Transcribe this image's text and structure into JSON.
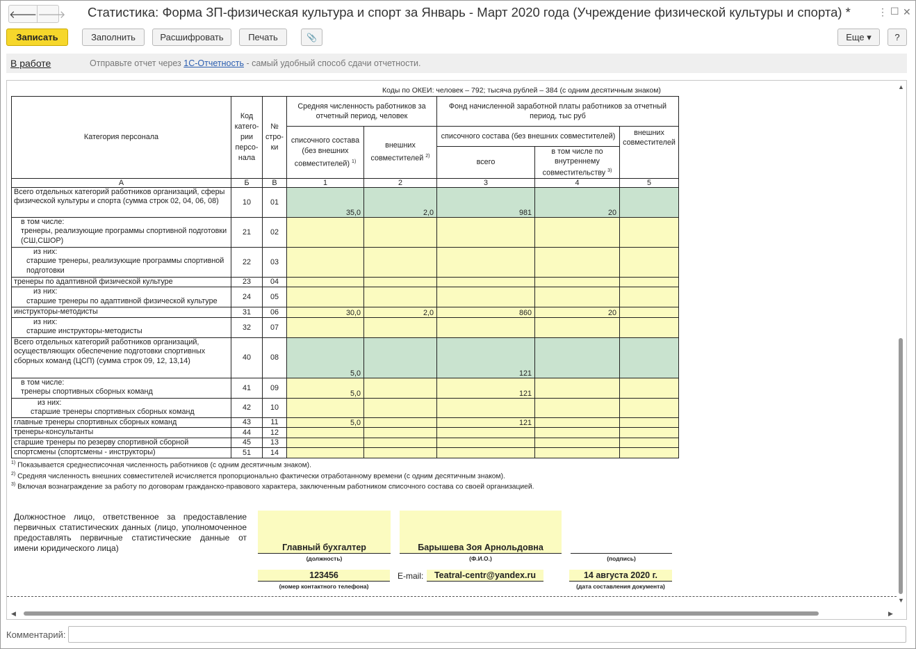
{
  "window": {
    "title": "Статистика: Форма ЗП-физическая культура и спорт за Январь - Март 2020 года (Учреждение физической культуры и спорта) *",
    "back_glyph": "🡐",
    "forward_glyph": "🡒",
    "menu_glyph": "⋮",
    "maximize_glyph": "☐",
    "close_glyph": "✕"
  },
  "toolbar": {
    "save": "Записать",
    "fill": "Заполнить",
    "decode": "Расшифровать",
    "print": "Печать",
    "attach_glyph": "📎",
    "more": "Еще ▾",
    "help": "?"
  },
  "status": {
    "state": "В работе",
    "hint_before": "Отправьте отчет через ",
    "hint_link": "1С-Отчетность",
    "hint_after": " - самый удобный способ сдачи отчетности."
  },
  "form": {
    "okei": "Коды по ОКЕИ: человек – 792; тысяча рублей – 384 (с одним десятичным знаком)",
    "headers": {
      "category": "Категория персонала",
      "code": "Код катего-рии персо-нала",
      "line_no": "№ стро-ки",
      "avg_headcount": "Средняя численность работников за отчетный период, человек",
      "payroll_fund": "Фонд начисленной заработной платы работников за отчетный период, тыс руб",
      "list_staff": "списочного состава (без внешних совместителей)",
      "list_staff_sup": "1)",
      "external": "внешних совместителей",
      "external_sup": "2)",
      "payroll_list_staff": "списочного состава (без внешних совместителей)",
      "total": "всего",
      "internal": "в том числе по внутреннему совместительству",
      "internal_sup": "3)",
      "payroll_external": "внешних совместителей",
      "col_a": "А",
      "col_b": "Б",
      "col_v": "В",
      "col_1": "1",
      "col_2": "2",
      "col_3": "3",
      "col_4": "4",
      "col_5": "5"
    },
    "rows": [
      {
        "category": "Всего отдельных категорий работников организаций, сферы физической культуры и спорта (сумма строк 02, 04, 06, 08)",
        "code": "10",
        "line": "01",
        "c1": "35,0",
        "c2": "2,0",
        "c3": "981",
        "c4": "20",
        "c5": "",
        "fill": "green"
      },
      {
        "category": "в том числе:\nтренеры, реализующие программы спортивной подготовки (СШ,СШОР)",
        "code": "21",
        "line": "02",
        "c1": "",
        "c2": "",
        "c3": "",
        "c4": "",
        "c5": "",
        "fill": "yellow"
      },
      {
        "category": "из них:\nстаршие тренеры, реализующие программы спортивной подготовки",
        "code": "22",
        "line": "03",
        "c1": "",
        "c2": "",
        "c3": "",
        "c4": "",
        "c5": "",
        "fill": "yellow"
      },
      {
        "category": "тренеры  по адаптивной физической культуре",
        "code": "23",
        "line": "04",
        "c1": "",
        "c2": "",
        "c3": "",
        "c4": "",
        "c5": "",
        "fill": "yellow"
      },
      {
        "category": "из них:\nстаршие тренеры по адаптивной физической культуре",
        "code": "24",
        "line": "05",
        "c1": "",
        "c2": "",
        "c3": "",
        "c4": "",
        "c5": "",
        "fill": "yellow"
      },
      {
        "category": "инструкторы-методисты",
        "code": "31",
        "line": "06",
        "c1": "30,0",
        "c2": "2,0",
        "c3": "860",
        "c4": "20",
        "c5": "",
        "fill": "yellow"
      },
      {
        "category": "из них:\nстаршие инструкторы-методисты",
        "code": "32",
        "line": "07",
        "c1": "",
        "c2": "",
        "c3": "",
        "c4": "",
        "c5": "",
        "fill": "yellow"
      },
      {
        "category": "Всего отдельных категорий работников организаций, осуществляющих обеспечение подготовки спортивных сборных команд (ЦСП) (сумма строк 09, 12, 13,14)",
        "code": "40",
        "line": "08",
        "c1": "5,0",
        "c2": "",
        "c3": "121",
        "c4": "",
        "c5": "",
        "fill": "green"
      },
      {
        "category": "в том числе:\nтренеры спортивных сборных команд",
        "code": "41",
        "line": "09",
        "c1": "5,0",
        "c2": "",
        "c3": "121",
        "c4": "",
        "c5": "",
        "fill": "yellow"
      },
      {
        "category": "из них:\nстаршие тренеры спортивных сборных команд",
        "code": "42",
        "line": "10",
        "c1": "",
        "c2": "",
        "c3": "",
        "c4": "",
        "c5": "",
        "fill": "yellow"
      },
      {
        "category": "главные тренеры спортивных сборных команд",
        "code": "43",
        "line": "11",
        "c1": "5,0",
        "c2": "",
        "c3": "121",
        "c4": "",
        "c5": "",
        "fill": "yellow"
      },
      {
        "category": "тренеры-консультанты",
        "code": "44",
        "line": "12",
        "c1": "",
        "c2": "",
        "c3": "",
        "c4": "",
        "c5": "",
        "fill": "yellow"
      },
      {
        "category": "старшие тренеры по резерву спортивной сборной",
        "code": "45",
        "line": "13",
        "c1": "",
        "c2": "",
        "c3": "",
        "c4": "",
        "c5": "",
        "fill": "yellow"
      },
      {
        "category": "спортсмены (спортсмены - инструкторы)",
        "code": "51",
        "line": "14",
        "c1": "",
        "c2": "",
        "c3": "",
        "c4": "",
        "c5": "",
        "fill": "yellow"
      }
    ],
    "footnotes": [
      {
        "mark": "1)",
        "text": " Показывается среднесписочная численность работников (с одним десятичным знаком)."
      },
      {
        "mark": "2)",
        "text": " Средняя численность внешних совместителей исчисляется пропорционально фактически отработанному времени (с одним десятичным знаком)."
      },
      {
        "mark": "3)",
        "text": " Включая вознаграждение за работу по договорам гражданско-правового характера, заключенным работником списочного состава со своей организацией."
      }
    ],
    "signature": {
      "responsible": "Должностное лицо, ответственное за предоставление первичных статистических данных (лицо, уполномоченное предоставлять первичные статистические данные от имени юридического лица)",
      "position": "Главный бухгалтер",
      "position_caption": "(должность)",
      "name": "Барышева Зоя Арнольдовна",
      "name_caption": "(Ф.И.О.)",
      "signature_caption": "(подпись)",
      "phone": "123456",
      "phone_caption": "(номер контактного телефона)",
      "email_label": "E-mail:",
      "email": "Teatral-centr@yandex.ru",
      "date": "14 августа 2020 г.",
      "date_caption": "(дата составления документа)"
    }
  },
  "comment": {
    "label": "Комментарий:",
    "value": ""
  }
}
